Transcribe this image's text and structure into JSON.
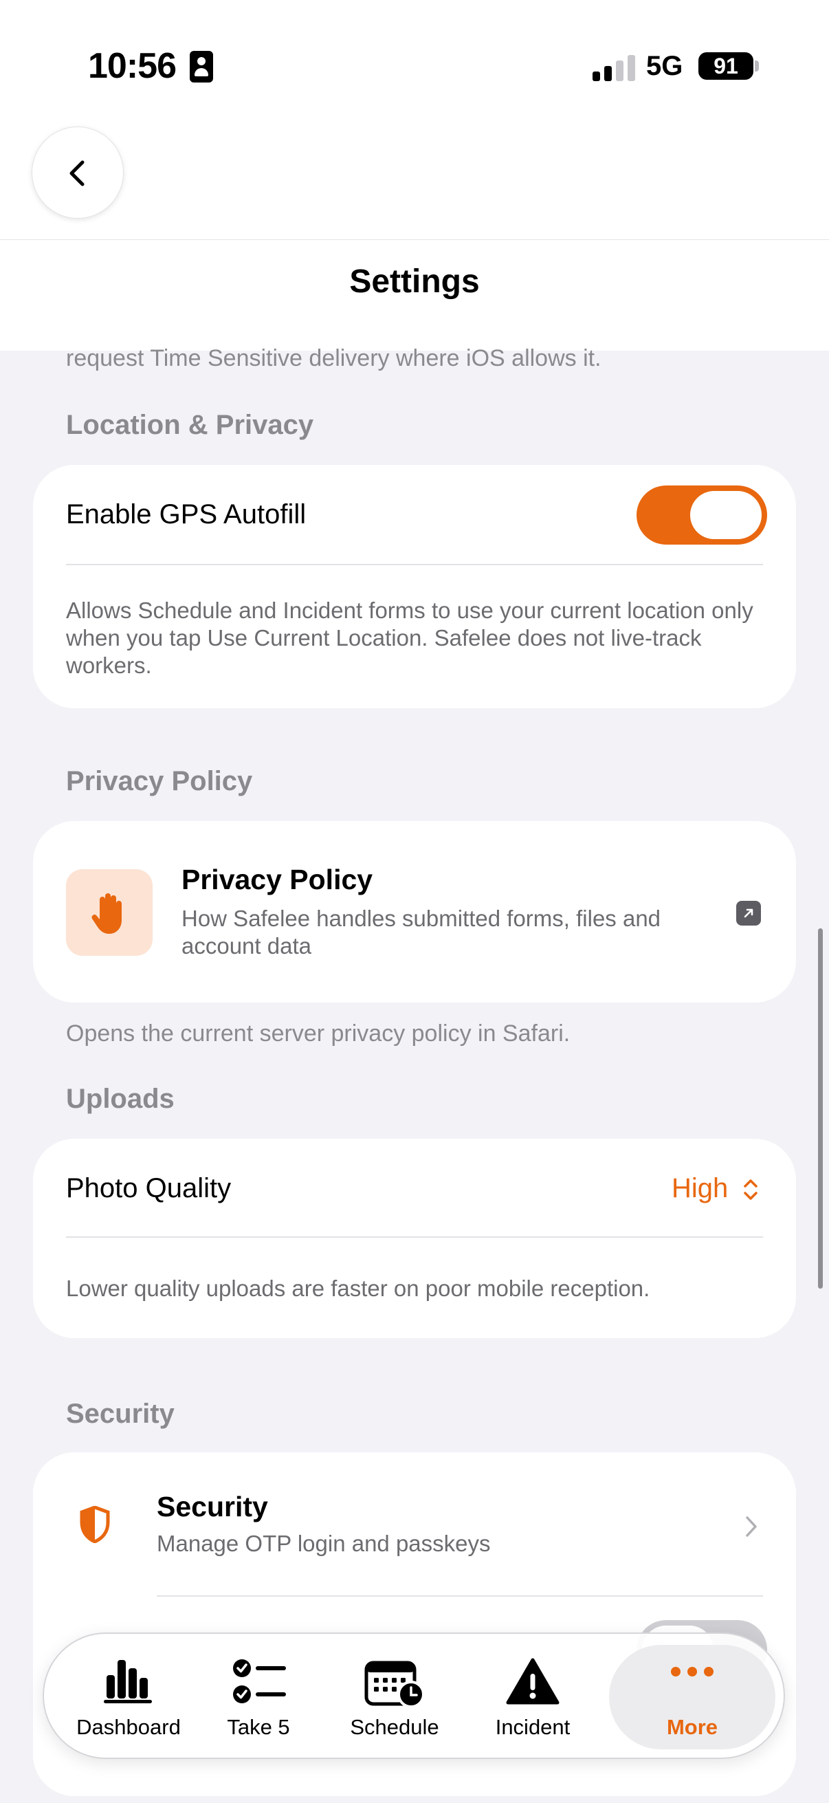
{
  "status_bar": {
    "time": "10:56",
    "network": "5G",
    "battery": "91"
  },
  "header": {
    "title": "Settings",
    "back_icon": "chevron-left-icon"
  },
  "notifications_footer": "request Time Sensitive delivery where iOS allows it.",
  "location_privacy": {
    "header": "Location & Privacy",
    "gps_label": "Enable GPS Autofill",
    "gps_enabled": true,
    "description": "Allows Schedule and Incident forms to use your current location only when you tap Use Current Location. Safelee does not live-track workers."
  },
  "privacy_policy": {
    "header": "Privacy Policy",
    "title": "Privacy Policy",
    "subtitle": "How Safelee handles submitted forms, files and account data",
    "icon": "hand-icon",
    "external_icon": "external-link-icon",
    "footer": "Opens the current server privacy policy in Safari."
  },
  "uploads": {
    "header": "Uploads",
    "photo_quality_label": "Photo Quality",
    "photo_quality_value": "High",
    "description": "Lower quality uploads are faster on poor mobile reception."
  },
  "security": {
    "header": "Security",
    "title": "Security",
    "subtitle": "Manage OTP login and passkeys",
    "icon": "shield-icon"
  },
  "tabbar": {
    "tabs": [
      {
        "label": "Dashboard",
        "icon": "bar-chart-icon",
        "active": false
      },
      {
        "label": "Take 5",
        "icon": "checklist-icon",
        "active": false
      },
      {
        "label": "Schedule",
        "icon": "calendar-clock-icon",
        "active": false
      },
      {
        "label": "Incident",
        "icon": "warning-icon",
        "active": false
      },
      {
        "label": "More",
        "icon": "more-dots-icon",
        "active": true
      }
    ]
  },
  "colors": {
    "accent": "#e8670f",
    "background": "#f2f2f7",
    "card": "#ffffff",
    "secondary_text": "#8a8a8e"
  }
}
